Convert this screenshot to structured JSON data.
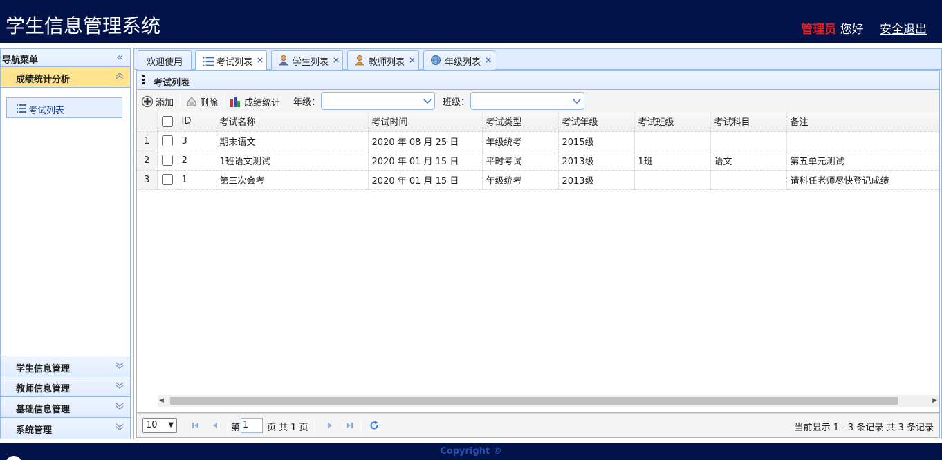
{
  "header": {
    "title": "学生信息管理系统",
    "user_role": "管理员",
    "greeting": "您好",
    "logout": "安全退出"
  },
  "sidebar": {
    "title": "导航菜单",
    "open_section": "成绩统计分析",
    "tree_item": "考试列表",
    "sections": [
      "学生信息管理",
      "教师信息管理",
      "基础信息管理",
      "系统管理"
    ]
  },
  "tabs": [
    {
      "label": "欢迎使用"
    },
    {
      "label": "考试列表",
      "icon": "list-icon"
    },
    {
      "label": "学生列表",
      "icon": "user-icon"
    },
    {
      "label": "教师列表",
      "icon": "user-icon"
    },
    {
      "label": "年级列表",
      "icon": "globe-icon"
    }
  ],
  "panel": {
    "title": "考试列表"
  },
  "toolbar": {
    "add": "添加",
    "delete": "删除",
    "stats": "成绩统计",
    "grade_label": "年级：",
    "class_label": "班级："
  },
  "grid": {
    "columns": [
      "ID",
      "考试名称",
      "考试时间",
      "考试类型",
      "考试年级",
      "考试班级",
      "考试科目",
      "备注"
    ],
    "rows": [
      {
        "rn": "1",
        "id": "3",
        "name": "期末语文",
        "time": "2020 年 08 月 25 日",
        "type": "年级统考",
        "grade": "2015级",
        "cls": "",
        "subject": "",
        "note": ""
      },
      {
        "rn": "2",
        "id": "2",
        "name": "1班语文测试",
        "time": "2020 年 01 月 15 日",
        "type": "平时考试",
        "grade": "2013级",
        "cls": "1班",
        "subject": "语文",
        "note": "第五单元测试"
      },
      {
        "rn": "3",
        "id": "1",
        "name": "第三次会考",
        "time": "2020 年 01 月 15 日",
        "type": "年级统考",
        "grade": "2013级",
        "cls": "",
        "subject": "",
        "note": "请科任老师尽快登记成绩"
      }
    ]
  },
  "pager": {
    "page_size": "10",
    "page_prefix": "第",
    "page_value": "1",
    "page_suffix": "页 共 1 页",
    "info": "当前显示 1 - 3 条记录 共 3 条记录"
  },
  "footer": {
    "text": "Copyright ©"
  },
  "colors": {
    "header_bg": "#021349",
    "accent_red": "#e02020",
    "border_blue": "#95b8e7",
    "open_section_bg": "#ffe48d"
  }
}
